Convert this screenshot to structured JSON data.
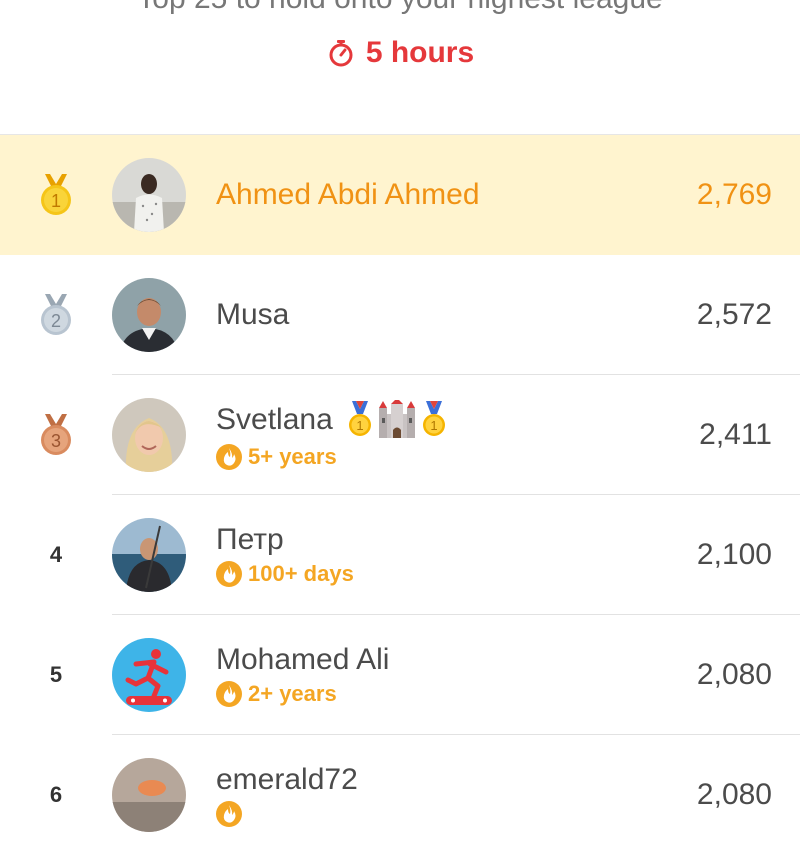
{
  "header": {
    "subtitle": "Top 25 to hold onto your highest league",
    "timer_text": "5 hours",
    "timer_icon": "stopwatch-icon",
    "timer_color": "#e5383b"
  },
  "colors": {
    "highlight_bg": "#fff4cf",
    "highlight_text": "#f09214",
    "streak": "#f4a623",
    "gold": "#f5c518",
    "silver": "#b8c4d0",
    "bronze": "#d98b5f"
  },
  "leaderboard": [
    {
      "rank": "1",
      "name": "Ahmed Abdi Ahmed",
      "score": "2,769",
      "streak": "",
      "medal": "gold-medal-icon",
      "highlight": true
    },
    {
      "rank": "2",
      "name": "Musa",
      "score": "2,572",
      "streak": "",
      "medal": "silver-medal-icon"
    },
    {
      "rank": "3",
      "name": "Svetlana",
      "score": "2,411",
      "streak": "5+ years",
      "medal": "bronze-medal-icon",
      "badges": [
        "first-place-medal-icon",
        "castle-icon",
        "first-place-medal-icon"
      ]
    },
    {
      "rank": "4",
      "name": "Петр",
      "score": "2,100",
      "streak": "100+ days"
    },
    {
      "rank": "5",
      "name": "Mohamed Ali",
      "score": "2,080",
      "streak": "2+ years"
    },
    {
      "rank": "6",
      "name": "emerald72",
      "score": "2,080",
      "streak": ""
    }
  ]
}
